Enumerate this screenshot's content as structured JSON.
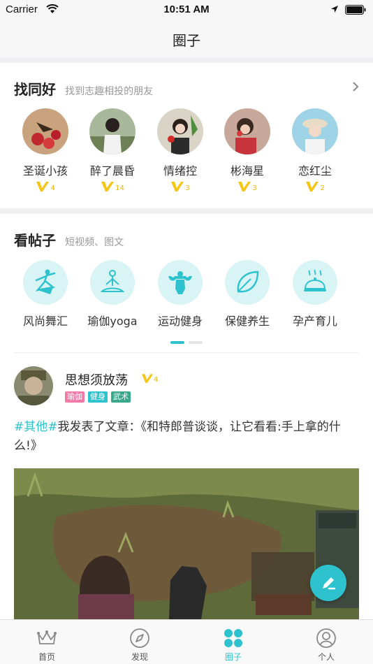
{
  "status_bar": {
    "carrier": "Carrier",
    "time": "10:51 AM"
  },
  "nav": {
    "title": "圈子"
  },
  "friends_section": {
    "title": "找同好",
    "subtitle": "找到志趣相投的朋友",
    "friends": [
      {
        "name": "圣诞小孩",
        "level": "4"
      },
      {
        "name": "醉了晨昏",
        "level": "14"
      },
      {
        "name": "情绪控",
        "level": "3"
      },
      {
        "name": "彬海星",
        "level": "3"
      },
      {
        "name": "恋红尘",
        "level": "2"
      }
    ]
  },
  "posts_section": {
    "title": "看帖子",
    "subtitle": "短视频、图文",
    "topics": [
      {
        "label": "风尚舞汇",
        "icon": "dancer-icon"
      },
      {
        "label": "瑜伽yoga",
        "icon": "yoga-icon"
      },
      {
        "label": "运动健身",
        "icon": "muscle-icon"
      },
      {
        "label": "保健养生",
        "icon": "leaf-icon"
      },
      {
        "label": "孕产育儿",
        "icon": "food-cloche-icon"
      }
    ]
  },
  "post": {
    "author": "思想须放荡",
    "author_level": "4",
    "tags": [
      {
        "label": "瑜伽",
        "color": "#f27aa8"
      },
      {
        "label": "健身",
        "color": "#2ec2ce"
      },
      {
        "label": "武术",
        "color": "#3aa88a"
      }
    ],
    "hashtag": "#其他#",
    "text": "我发表了文章：《和特郎普谈谈，让它看看:手上拿的什么!》"
  },
  "tab_bar": {
    "tabs": [
      {
        "label": "首页",
        "icon": "crown-icon"
      },
      {
        "label": "发现",
        "icon": "compass-icon"
      },
      {
        "label": "圈子",
        "icon": "clover-icon"
      },
      {
        "label": "个人",
        "icon": "user-icon"
      }
    ]
  },
  "colors": {
    "accent": "#2ec2ce",
    "vip": "#f5c518",
    "background_band": "#efeff2"
  }
}
